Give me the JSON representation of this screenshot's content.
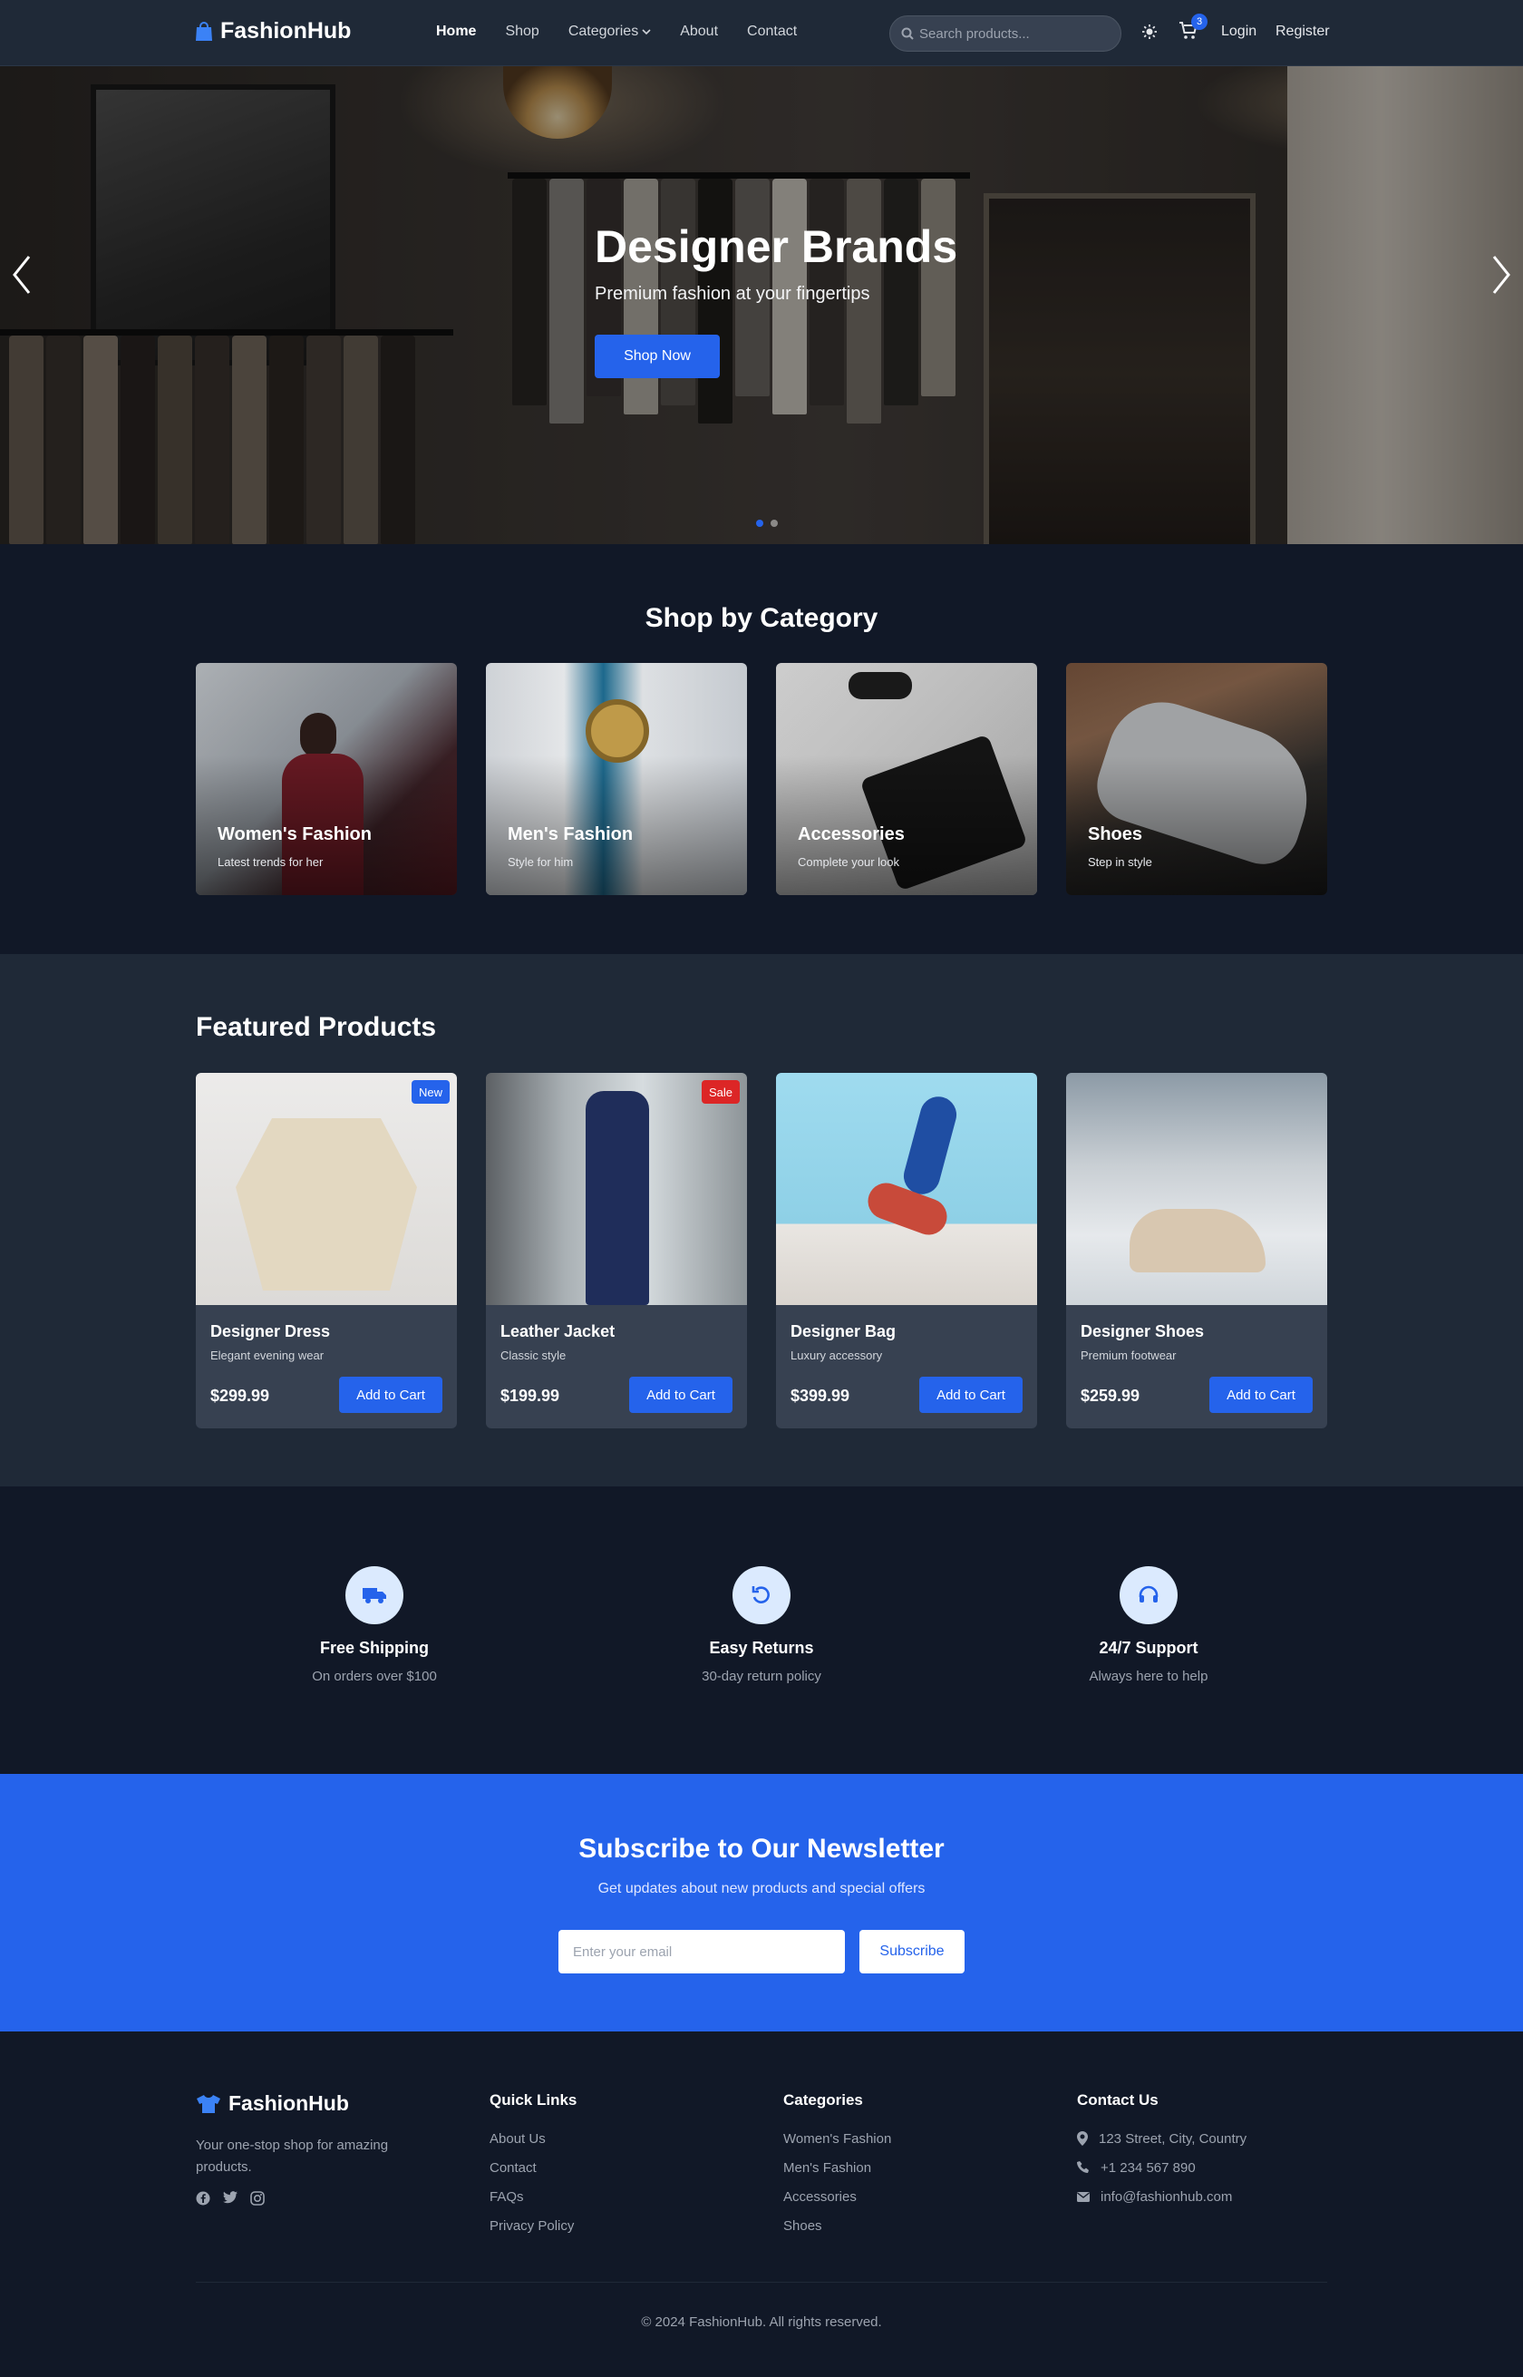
{
  "brand": {
    "name": "FashionHub",
    "accent": "#2563eb"
  },
  "nav": {
    "links": [
      {
        "label": "Home",
        "active": true
      },
      {
        "label": "Shop"
      },
      {
        "label": "Categories"
      },
      {
        "label": "About"
      },
      {
        "label": "Contact"
      }
    ],
    "search_placeholder": "Search products...",
    "cart_count": "3",
    "login": "Login",
    "register": "Register"
  },
  "hero": {
    "title": "Designer Brands",
    "subtitle": "Premium fashion at your fingertips",
    "cta": "Shop Now",
    "slide_count": 2,
    "active_slide": 1
  },
  "categories": {
    "title": "Shop by Category",
    "items": [
      {
        "name": "Women's Fashion",
        "desc": "Latest trends for her"
      },
      {
        "name": "Men's Fashion",
        "desc": "Style for him"
      },
      {
        "name": "Accessories",
        "desc": "Complete your look"
      },
      {
        "name": "Shoes",
        "desc": "Step in style"
      }
    ]
  },
  "featured": {
    "title": "Featured Products",
    "products": [
      {
        "name": "Designer Dress",
        "desc": "Elegant evening wear",
        "price": "$299.99",
        "badge": "New",
        "badge_color": "#2563eb",
        "cta": "Add to Cart"
      },
      {
        "name": "Leather Jacket",
        "desc": "Classic style",
        "price": "$199.99",
        "badge": "Sale",
        "badge_color": "#dc2626",
        "cta": "Add to Cart"
      },
      {
        "name": "Designer Bag",
        "desc": "Luxury accessory",
        "price": "$399.99",
        "badge": "",
        "cta": "Add to Cart"
      },
      {
        "name": "Designer Shoes",
        "desc": "Premium footwear",
        "price": "$259.99",
        "badge": "",
        "cta": "Add to Cart"
      }
    ]
  },
  "features": [
    {
      "icon": "truck-icon",
      "title": "Free Shipping",
      "desc": "On orders over $100"
    },
    {
      "icon": "return-icon",
      "title": "Easy Returns",
      "desc": "30-day return policy"
    },
    {
      "icon": "headset-icon",
      "title": "24/7 Support",
      "desc": "Always here to help"
    }
  ],
  "newsletter": {
    "title": "Subscribe to Our Newsletter",
    "subtitle": "Get updates about new products and special offers",
    "placeholder": "Enter your email",
    "button": "Subscribe"
  },
  "footer": {
    "brand": "FashionHub",
    "tagline": "Your one-stop shop for amazing products.",
    "social": [
      "facebook-icon",
      "twitter-icon",
      "instagram-icon"
    ],
    "quick_links": {
      "title": "Quick Links",
      "items": [
        "About Us",
        "Contact",
        "FAQs",
        "Privacy Policy"
      ]
    },
    "categories": {
      "title": "Categories",
      "items": [
        "Women's Fashion",
        "Men's Fashion",
        "Accessories",
        "Shoes"
      ]
    },
    "contact": {
      "title": "Contact Us",
      "address": "123 Street, City, Country",
      "phone": "+1 234 567 890",
      "email": "info@fashionhub.com"
    },
    "copyright": "© 2024 FashionHub. All rights reserved."
  }
}
